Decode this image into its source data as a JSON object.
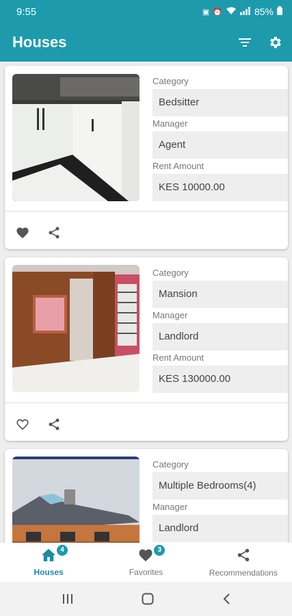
{
  "status": {
    "time": "9:55",
    "battery": "85%"
  },
  "appbar": {
    "title": "Houses",
    "filter_icon": "filter-icon",
    "settings_icon": "gear-icon"
  },
  "listings": [
    {
      "category_label": "Category",
      "category": "Bedsitter",
      "manager_label": "Manager",
      "manager": "Agent",
      "rent_label": "Rent Amount",
      "rent": "KES 10000.00",
      "favorited": true
    },
    {
      "category_label": "Category",
      "category": "Mansion",
      "manager_label": "Manager",
      "manager": "Landlord",
      "rent_label": "Rent Amount",
      "rent": "KES 130000.00",
      "favorited": false
    },
    {
      "category_label": "Category",
      "category": "Multiple Bedrooms(4)",
      "manager_label": "Manager",
      "manager": "Landlord"
    }
  ],
  "bottom_nav": {
    "houses": {
      "label": "Houses",
      "badge": "4"
    },
    "favorites": {
      "label": "Favorites",
      "badge": "3"
    },
    "recommendations": {
      "label": "Recommendations"
    }
  },
  "colors": {
    "primary": "#1e9aad",
    "field_bg": "#eeeeee"
  }
}
